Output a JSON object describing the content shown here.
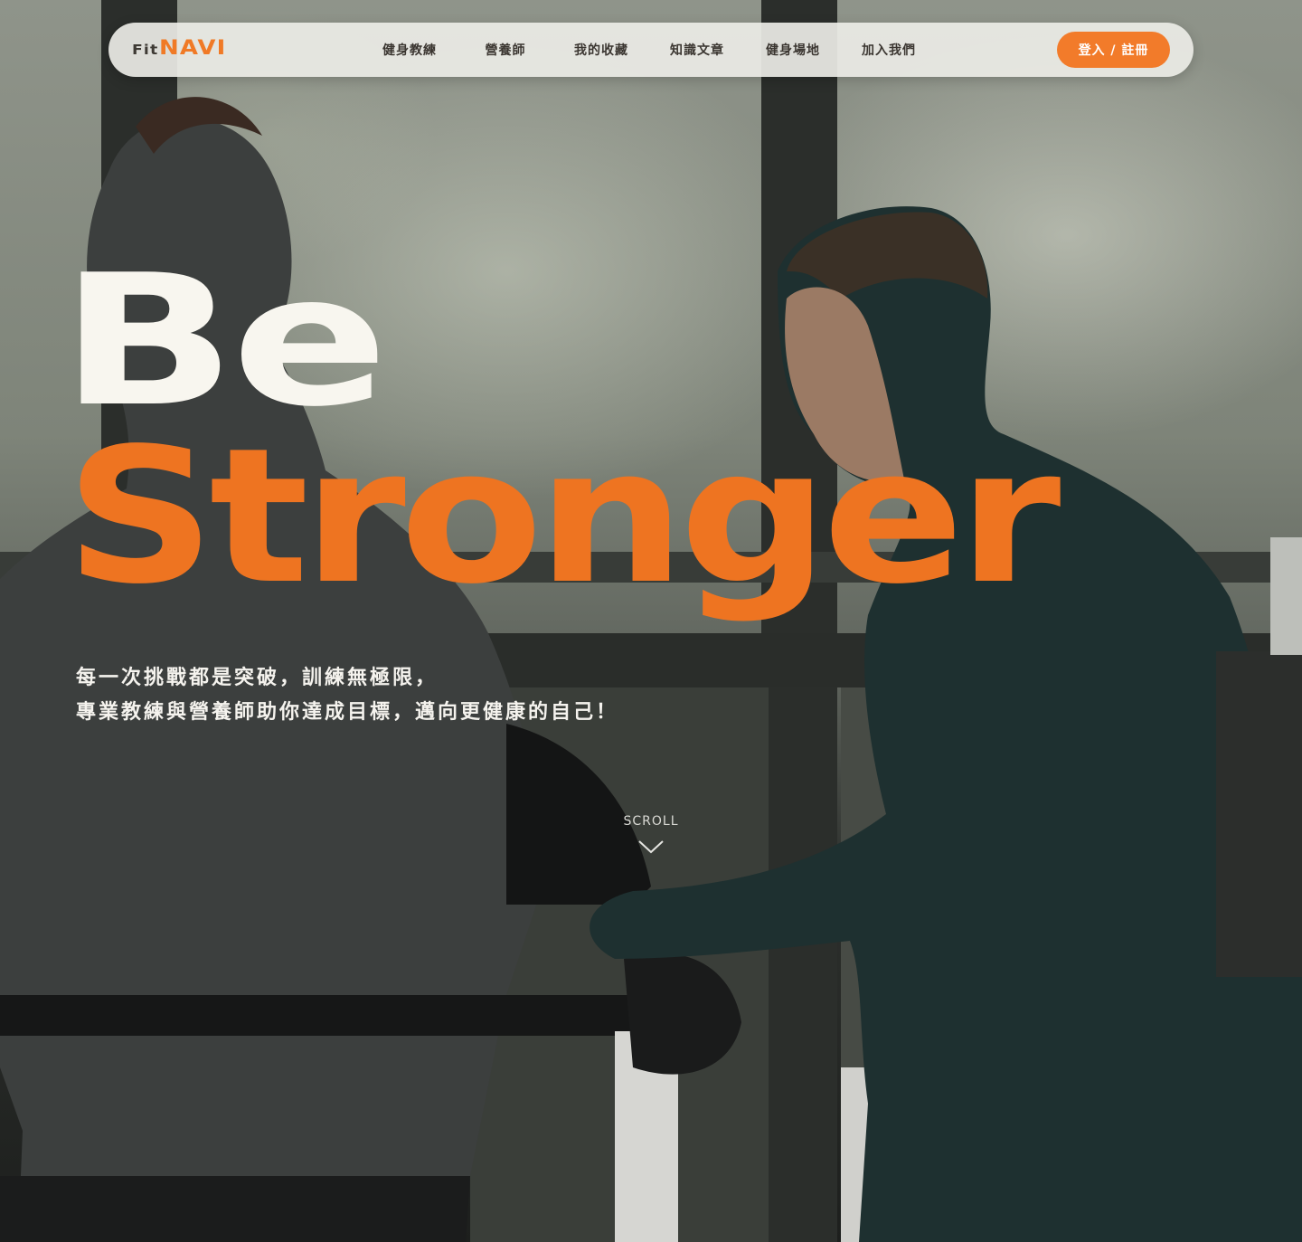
{
  "logo": {
    "part1": "Fit",
    "part2": "NAVI"
  },
  "nav": {
    "items": [
      {
        "label": "健身教練"
      },
      {
        "label": "營養師"
      },
      {
        "label": "我的收藏"
      },
      {
        "label": "知識文章"
      },
      {
        "label": "健身場地"
      },
      {
        "label": "加入我們"
      }
    ],
    "login_label": "登入 / 註冊"
  },
  "hero": {
    "headline_line1": "Be",
    "headline_line2": "Stronger",
    "subtitle_line1": "每一次挑戰都是突破，訓練無極限，",
    "subtitle_line2": "專業教練與營養師助你達成目標，邁向更健康的自己！"
  },
  "scroll": {
    "label": "SCROLL",
    "icon": "chevron-down-icon"
  },
  "colors": {
    "accent": "#F07A26",
    "headline_light": "#F8F6EF",
    "nav_bg": "#ECECE6"
  }
}
